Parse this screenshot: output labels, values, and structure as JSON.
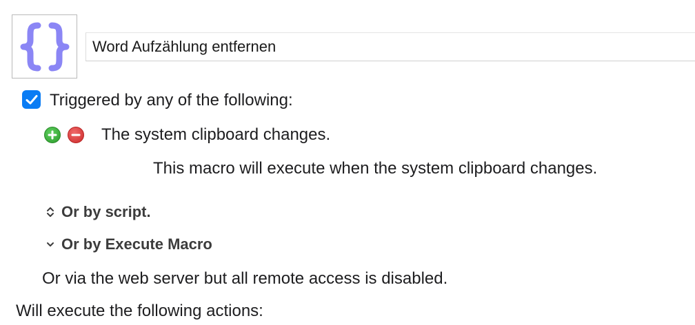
{
  "macro": {
    "name": "Word Aufzählung entfernen",
    "icon": "curly-braces-icon",
    "icon_color": "#8b86f5"
  },
  "triggers": {
    "enabled": true,
    "checkbox_color": "#0a7cf4",
    "header": "Triggered by any of the following:",
    "items": [
      {
        "title": "The system clipboard changes.",
        "description": "This macro will execute when the system clipboard changes."
      }
    ],
    "or_by_script": "Or by script.",
    "or_by_execute_macro": "Or by Execute Macro",
    "web_server_note": "Or via the web server but all remote access is disabled."
  },
  "actions": {
    "header": "Will execute the following actions:"
  }
}
